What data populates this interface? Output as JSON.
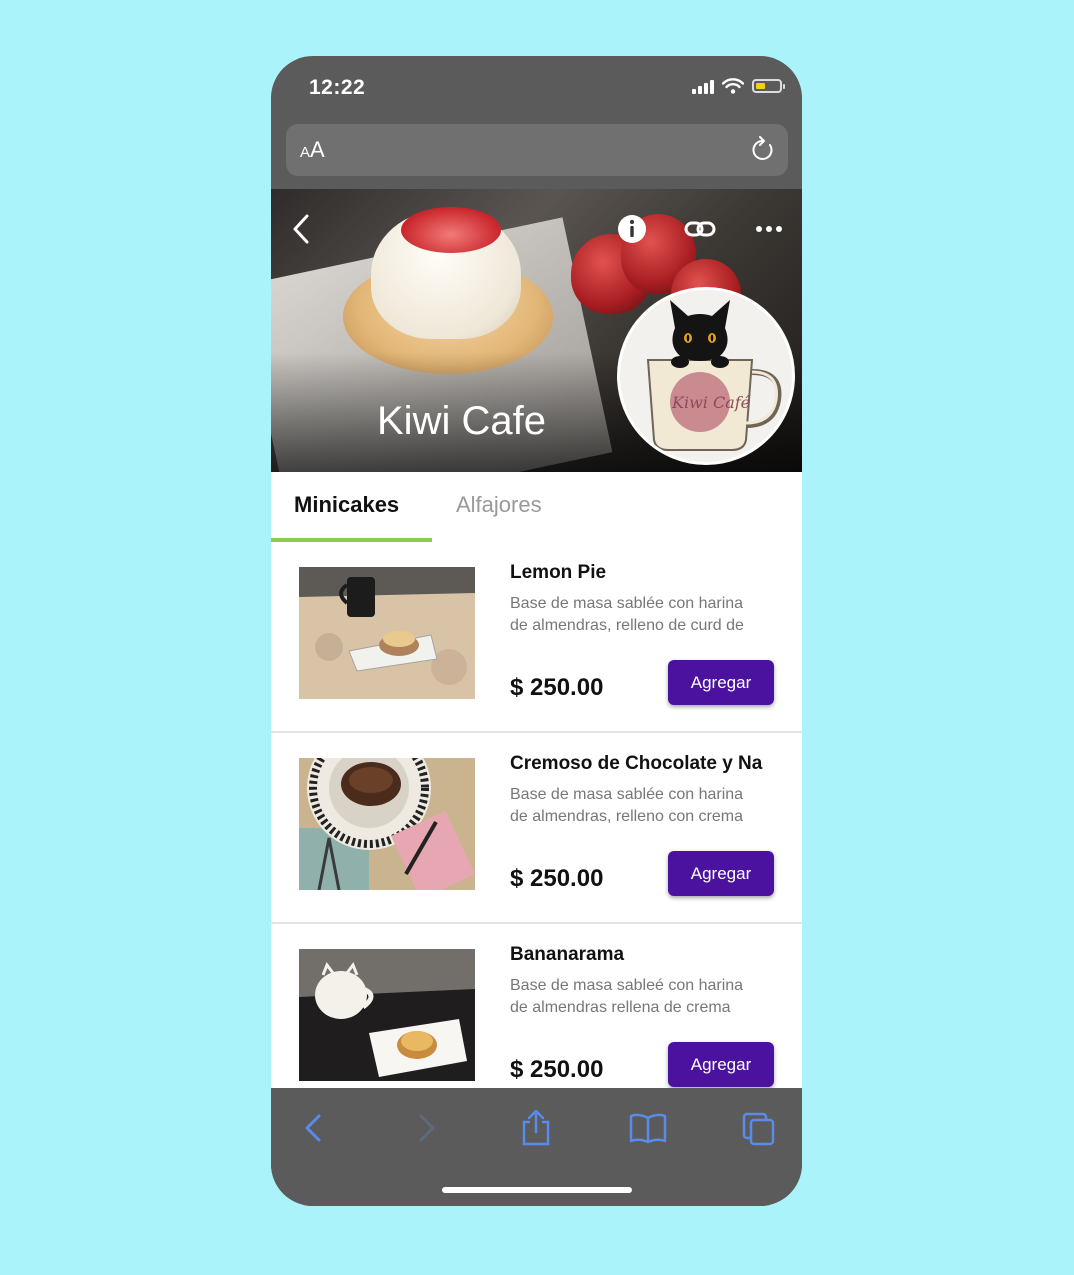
{
  "status_bar": {
    "time": "12:22",
    "battery_color": "#f5d10a"
  },
  "address_bar": {
    "aa_small": "A",
    "aa_large": "A"
  },
  "hero": {
    "title": "Kiwi Cafe",
    "logo_text": "Kiwi Café"
  },
  "tabs": [
    {
      "label": "Minicakes",
      "active": true
    },
    {
      "label": "Alfajores",
      "active": false
    }
  ],
  "accent_color": "#8dca50",
  "button_color": "#4a129e",
  "products": [
    {
      "name": "Lemon Pie",
      "description": "Base de masa sablée con harina\nde almendras, relleno de curd de",
      "price": "$ 250.00",
      "button_label": "Agregar"
    },
    {
      "name": "Cremoso de Chocolate y Na",
      "description": "Base de masa sablée con harina\nde almendras, relleno con crema",
      "price": "$ 250.00",
      "button_label": "Agregar"
    },
    {
      "name": "Bananarama",
      "description": "Base de masa sableé con harina\nde almendras rellena de  crema",
      "price": "$ 250.00",
      "button_label": "Agregar"
    }
  ]
}
